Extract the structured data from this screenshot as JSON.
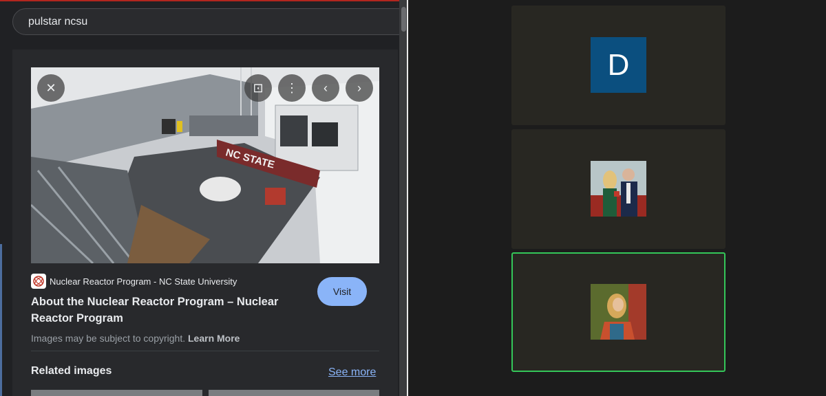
{
  "browser": {
    "search_query": "pulstar ncsu",
    "image_panel": {
      "close_icon": "close-icon",
      "lens_icon": "lens-icon",
      "more_icon": "more-vert-icon",
      "prev_icon": "chevron-left-icon",
      "next_icon": "chevron-right-icon",
      "source_name": "Nuclear Reactor Program - NC State University",
      "title": "About the Nuclear Reactor Program – Nuclear Reactor Program",
      "visit_label": "Visit",
      "copyright_text": "Images may be subject to copyright.",
      "learn_more_label": "Learn More",
      "related_label": "Related images",
      "see_more_label": "See more",
      "image_banner_text": "NC STATE"
    }
  },
  "video_call": {
    "participant_initial": "D",
    "accent_active": "#34c759"
  }
}
